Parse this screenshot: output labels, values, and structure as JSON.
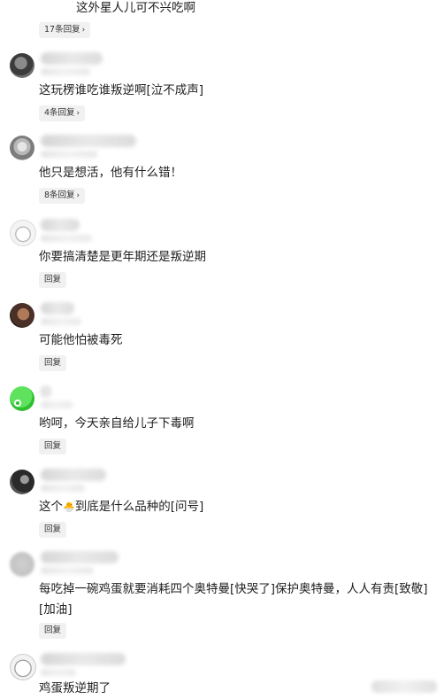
{
  "comments": [
    {
      "text": "这外星人儿可不兴吃啊",
      "reply": "17条回复",
      "has_chevron": true
    },
    {
      "text": "这玩楞谁吃谁叛逆啊[泣不成声]",
      "reply": "4条回复",
      "has_chevron": true
    },
    {
      "text": "他只是想活，他有什么错！",
      "reply": "8条回复",
      "has_chevron": true
    },
    {
      "text": "你要搞清楚是更年期还是叛逆期",
      "reply": "回复",
      "has_chevron": false
    },
    {
      "text": "可能他怕被毒死",
      "reply": "回复",
      "has_chevron": false
    },
    {
      "text": "哟呵，今天亲自给儿子下毒啊",
      "reply": "回复",
      "has_chevron": false
    },
    {
      "text_before": "这个",
      "text_after": "到底是什么品种的[问号]",
      "reply": "回复",
      "has_chevron": false
    },
    {
      "text": "每吃掉一碗鸡蛋就要消耗四个奥特曼[快哭了]保护奥特曼，人人有责[致敬][加油]",
      "reply": "回复",
      "has_chevron": false
    },
    {
      "text": "鸡蛋叛逆期了"
    }
  ],
  "icons": {
    "chevron": "chevron-right-icon",
    "chick": "chick-emoji-icon"
  },
  "colors": {
    "background": "#ffffff",
    "text": "#1e1e1e",
    "reply_bg": "#f1f1f1"
  }
}
